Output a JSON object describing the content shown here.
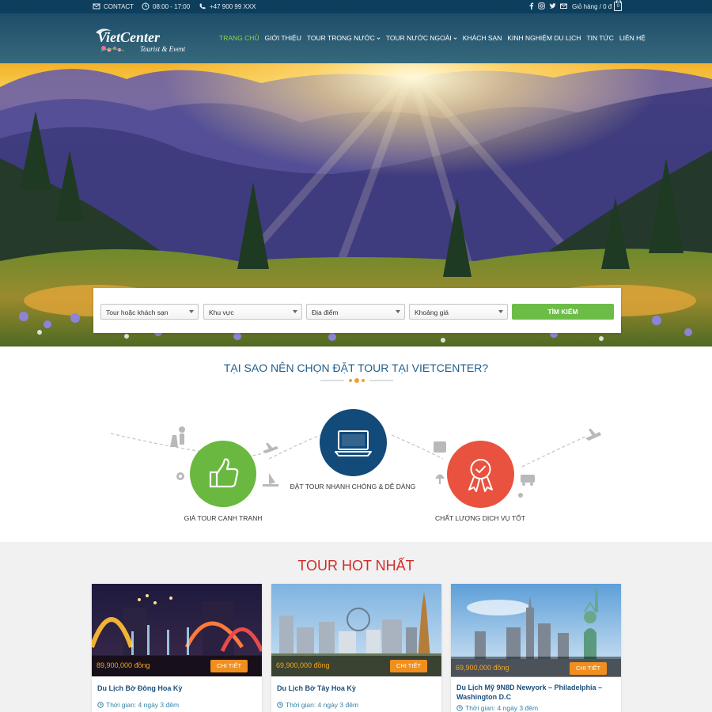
{
  "topbar": {
    "contact": "CONTACT",
    "hours": "08:00 - 17:00",
    "phone": "+47 900 99 XXX",
    "social_icons": [
      "facebook-icon",
      "instagram-icon",
      "twitter-icon",
      "mail-icon"
    ],
    "cart_label": "Giỏ hàng / 0 đ",
    "cart_count": "0"
  },
  "header": {
    "logo_line1": "VietCenter",
    "logo_line2": "Tourist & Event",
    "nav": [
      {
        "label": "TRANG CHỦ"
      },
      {
        "label": "GIỚI THIỆU"
      },
      {
        "label": "TOUR TRONG NƯỚC"
      },
      {
        "label": "TOUR NƯỚC NGOÀI"
      },
      {
        "label": "KHÁCH SẠN"
      },
      {
        "label": "KINH NGHIỆM DU LỊCH"
      },
      {
        "label": "TIN TỨC"
      },
      {
        "label": "LIÊN HỆ"
      }
    ]
  },
  "search": {
    "field1": "Tour hoặc khách sạn",
    "field2": "Khu vực",
    "field3": "Địa điểm",
    "field4": "Khoảng giá",
    "button": "TÌM KIẾM"
  },
  "why": {
    "title": "TẠI SAO NÊN CHỌN ĐẶT TOUR TẠI VIETCENTER?",
    "features": [
      {
        "label": "GIÁ TOUR CẠNH TRANH",
        "icon": "thumbs-up-icon"
      },
      {
        "label": "ĐẶT TOUR NHANH CHÓNG & DỄ DÀNG",
        "icon": "laptop-icon"
      },
      {
        "label": "CHẤT LƯỢNG DỊCH VỤ TỐT",
        "icon": "award-badge-icon"
      }
    ]
  },
  "hot": {
    "title": "TOUR HOT NHẤT",
    "detail_label": "CHI TIẾT",
    "tours": [
      {
        "price": "89,900,000 đồng",
        "title": "Du Lịch Bờ Đông Hoa Kỳ",
        "time": "Thời gian: 4 ngày 3 đêm"
      },
      {
        "price": "69,900,000 đồng",
        "title": "Du Lịch Bờ Tây Hoa Kỳ",
        "time": "Thời gian: 4 ngày 3 đêm"
      },
      {
        "price": "69,900,000 đồng",
        "title": "Du Lịch Mỹ 9N8D Newyork – Philadelphia – Washington D.C",
        "time": "Thời gian: 4 ngày 3 đêm"
      }
    ]
  },
  "colors": {
    "topbar": "#0d3f5d",
    "nav_active": "#8fd14f",
    "search_button": "#6cbd47",
    "feature_green": "#6ab83f",
    "feature_blue": "#124a7a",
    "feature_red": "#e8523f",
    "hot_title": "#d32a2a",
    "price": "#f6a623",
    "detail_button": "#f08f1e"
  }
}
